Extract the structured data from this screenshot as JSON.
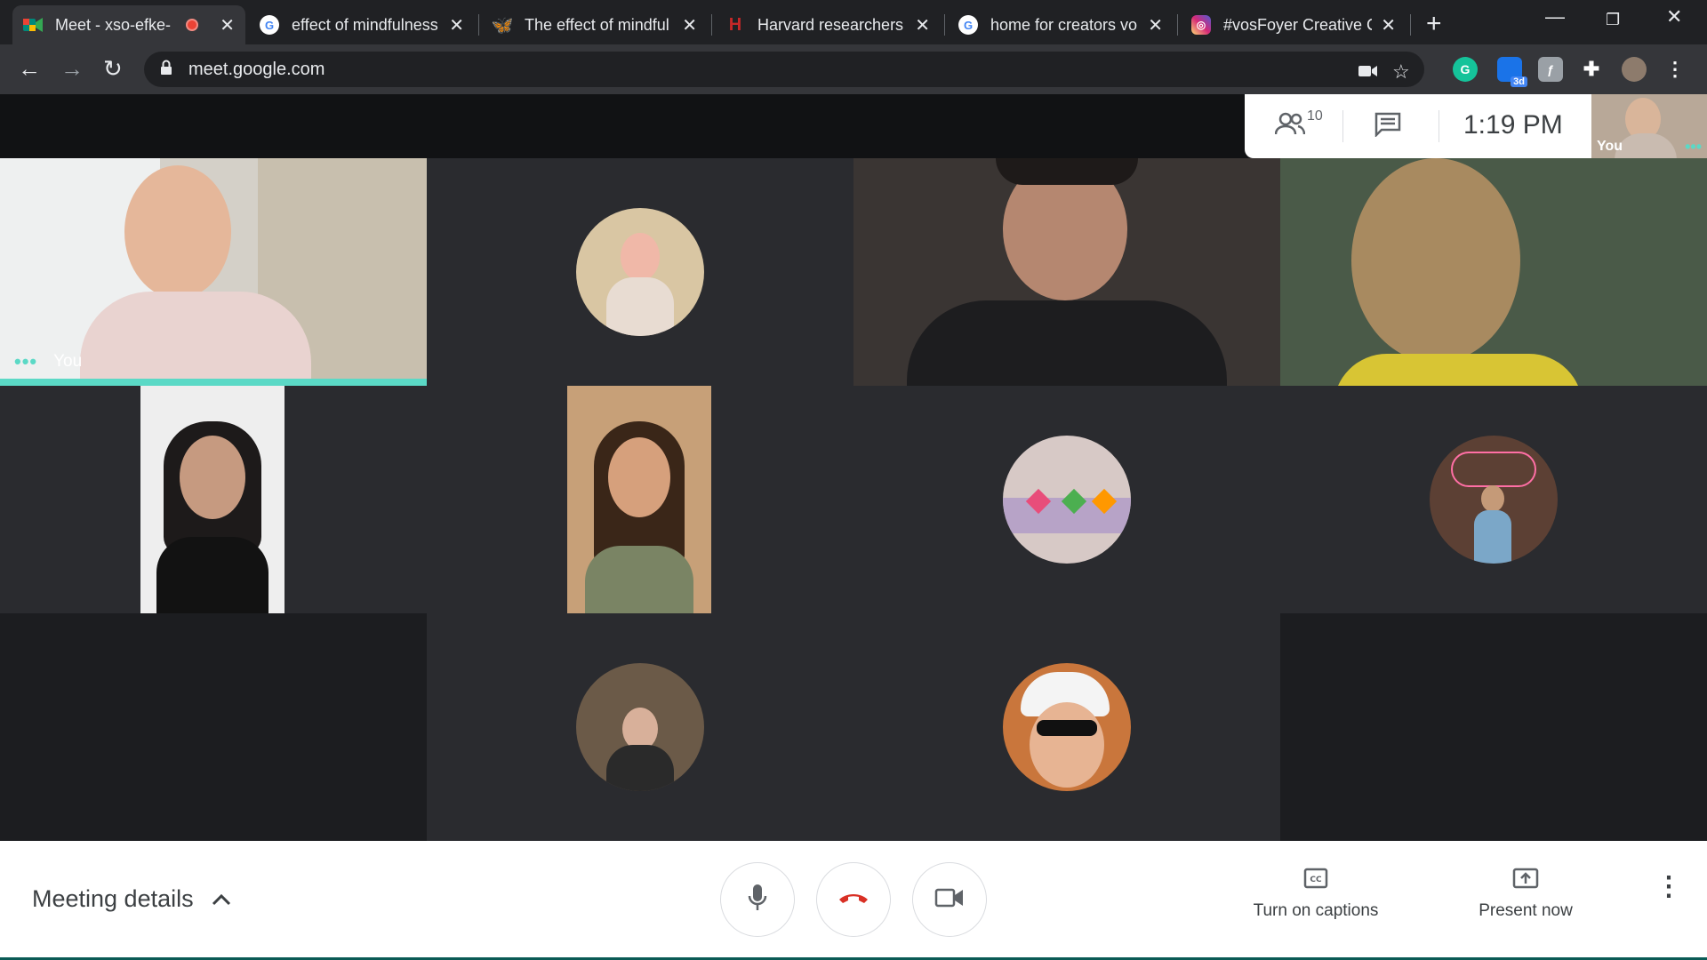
{
  "browser": {
    "tabs": [
      {
        "title": "Meet - xso-efke-",
        "favicon": "google-meet-icon",
        "active": true,
        "recording": true
      },
      {
        "title": "effect of mindfulness",
        "favicon": "google-icon",
        "active": false
      },
      {
        "title": "The effect of mindful",
        "favicon": "butterfly-icon",
        "active": false
      },
      {
        "title": "Harvard researchers",
        "favicon": "harvard-icon",
        "active": false
      },
      {
        "title": "home for creators vo",
        "favicon": "google-icon",
        "active": false
      },
      {
        "title": "#vosFoyer Creative C",
        "favicon": "instagram-icon",
        "active": false
      }
    ],
    "url": "meet.google.com",
    "extensions": [
      "grammarly-icon",
      "extension-badge-icon",
      "extension-icon",
      "puzzle-icon",
      "profile-avatar"
    ],
    "extension_badge": "3d"
  },
  "meet": {
    "participant_count": "10",
    "time": "1:19 PM",
    "self_label": "You",
    "meeting_details_label": "Meeting details",
    "captions_label": "Turn on captions",
    "present_label": "Present now",
    "colors": {
      "accent": "#5bd9c6",
      "hangup": "#d93025",
      "tab_bg": "#202124",
      "stage_bg": "#202124"
    }
  }
}
